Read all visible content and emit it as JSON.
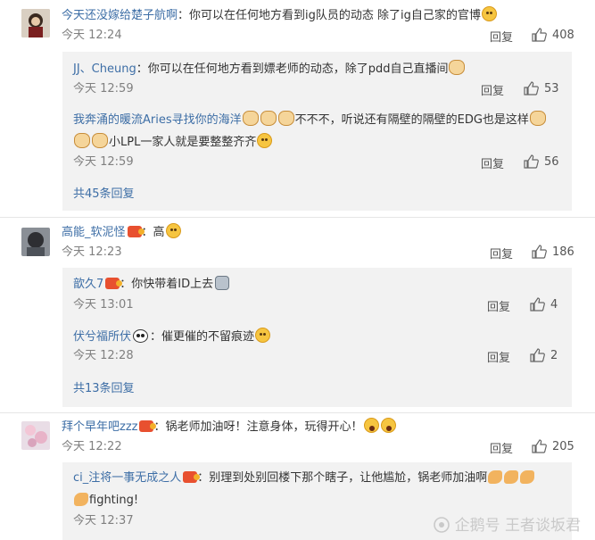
{
  "labels": {
    "reply": "回复"
  },
  "comments": [
    {
      "user": "今天还没嫁给楚子航啊",
      "text": "：你可以在任何地方看到ig队员的动态 除了ig自己家的官博",
      "time": "今天 12:24",
      "likes": "408",
      "replies": [
        {
          "user": "JJ、Cheung",
          "text": "：你可以在任何地方看到嫖老师的动态，除了pdd自己直播间",
          "time": "今天 12:59",
          "likes": "53"
        },
        {
          "user": "我奔涌的暖流Aries寻找你的海洋",
          "text": "不不不，听说还有隔壁的隔壁的EDG也是这样",
          "text2": "小LPL一家人就是要整整齐齐",
          "time": "今天 12:59",
          "likes": "56"
        }
      ],
      "more": "共45条回复"
    },
    {
      "user": "高能_软泥怪",
      "text": "：高",
      "time": "今天 12:23",
      "likes": "186",
      "replies": [
        {
          "user": "歆久7",
          "text": "：你快带着ID上去",
          "time": "今天 13:01",
          "likes": "4"
        },
        {
          "user": "伏兮福所伏",
          "text": "：催更催的不留痕迹",
          "time": "今天 12:28",
          "likes": "2"
        }
      ],
      "more": "共13条回复"
    },
    {
      "user": "拜个早年吧zzz",
      "text": "：锅老师加油呀！注意身体，玩得开心！",
      "time": "今天 12:22",
      "likes": "205",
      "replies": [
        {
          "user": "ci_注将一事无成之人",
          "text": "：别理到处别回楼下那个瞎子，让他尴尬，锅老师加油啊",
          "text2": "fighting!",
          "time": "今天 12:37",
          "likes": ""
        }
      ]
    }
  ],
  "watermark": "企鹅号 王者谈坂君"
}
